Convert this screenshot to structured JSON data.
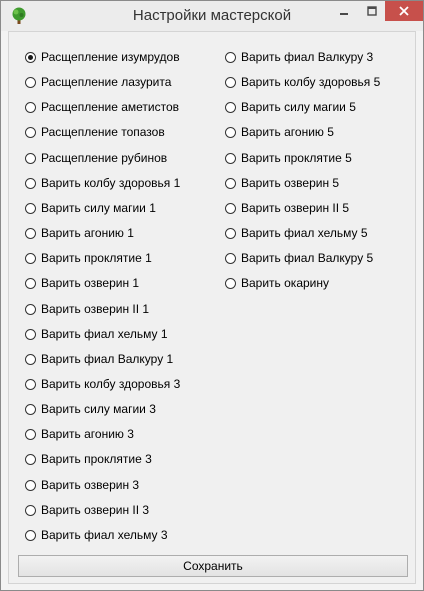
{
  "window": {
    "title": "Настройки мастерской",
    "icon": "tree-icon"
  },
  "options": [
    {
      "label": "Расщепление изумрудов",
      "checked": true
    },
    {
      "label": "Расщепление лазурита",
      "checked": false
    },
    {
      "label": "Расщепление аметистов",
      "checked": false
    },
    {
      "label": "Расщепление топазов",
      "checked": false
    },
    {
      "label": "Расщепление рубинов",
      "checked": false
    },
    {
      "label": "Варить колбу здоровья 1",
      "checked": false
    },
    {
      "label": "Варить силу магии 1",
      "checked": false
    },
    {
      "label": "Варить агонию 1",
      "checked": false
    },
    {
      "label": "Варить проклятие 1",
      "checked": false
    },
    {
      "label": "Варить озверин 1",
      "checked": false
    },
    {
      "label": "Варить озверин II 1",
      "checked": false
    },
    {
      "label": "Варить фиал хельму 1",
      "checked": false
    },
    {
      "label": "Варить фиал Валкуру 1",
      "checked": false
    },
    {
      "label": "Варить колбу здоровья 3",
      "checked": false
    },
    {
      "label": "Варить силу магии 3",
      "checked": false
    },
    {
      "label": "Варить агонию 3",
      "checked": false
    },
    {
      "label": "Варить проклятие 3",
      "checked": false
    },
    {
      "label": "Варить озверин 3",
      "checked": false
    },
    {
      "label": "Варить озверин II 3",
      "checked": false
    },
    {
      "label": "Варить фиал хельму 3",
      "checked": false
    },
    {
      "label": "Варить фиал Валкуру 3",
      "checked": false
    },
    {
      "label": "Варить колбу здоровья 5",
      "checked": false
    },
    {
      "label": "Варить силу магии 5",
      "checked": false
    },
    {
      "label": "Варить агонию 5",
      "checked": false
    },
    {
      "label": "Варить проклятие 5",
      "checked": false
    },
    {
      "label": "Варить озверин 5",
      "checked": false
    },
    {
      "label": "Варить озверин II 5",
      "checked": false
    },
    {
      "label": "Варить фиал хельму 5",
      "checked": false
    },
    {
      "label": "Варить фиал Валкуру 5",
      "checked": false
    },
    {
      "label": "Варить окарину",
      "checked": false
    }
  ],
  "buttons": {
    "save_label": "Сохранить"
  },
  "colors": {
    "close_button": "#c7504b",
    "window_bg": "#f0f0f0"
  }
}
